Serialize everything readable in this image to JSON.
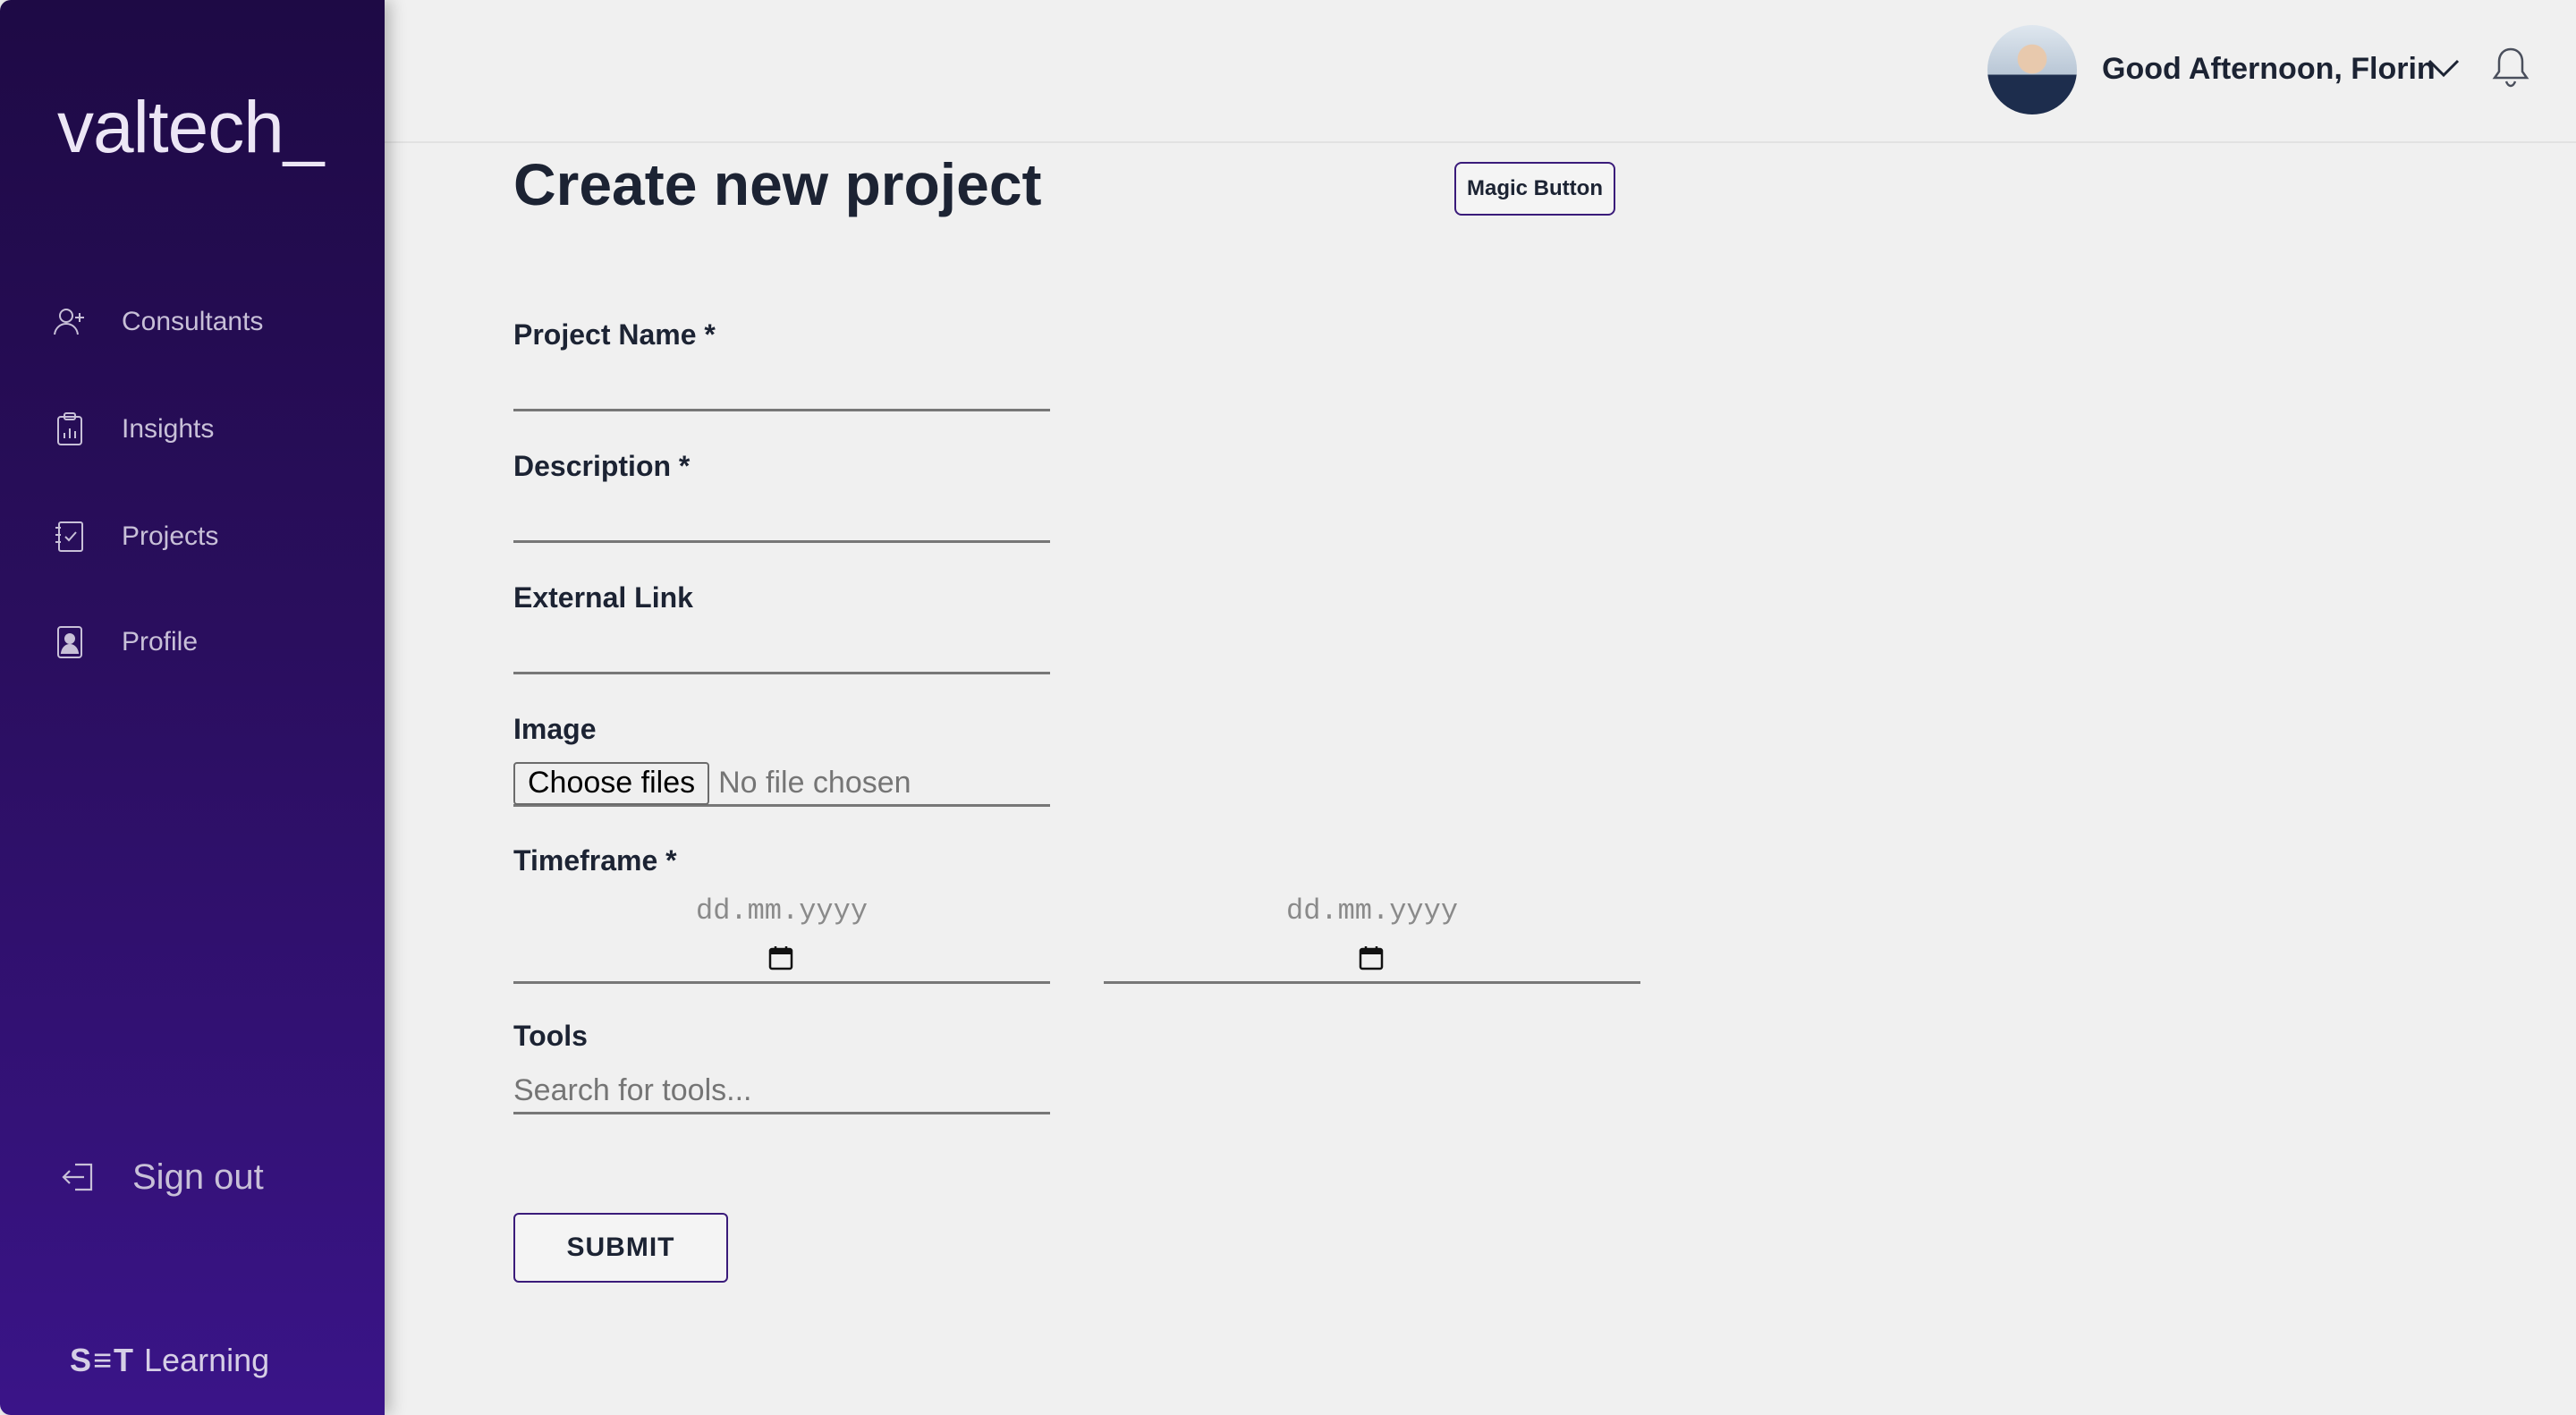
{
  "sidebar": {
    "logo": "valtech_",
    "items": [
      {
        "label": "Consultants",
        "icon": "add-user-icon"
      },
      {
        "label": "Insights",
        "icon": "clipboard-chart-icon"
      },
      {
        "label": "Projects",
        "icon": "checklist-icon"
      },
      {
        "label": "Profile",
        "icon": "profile-card-icon"
      }
    ],
    "signout": {
      "label": "Sign out",
      "icon": "sign-out-icon"
    },
    "footer": {
      "brand": "S≡T",
      "suffix": "Learning"
    }
  },
  "header": {
    "greeting": "Good Afternoon, Florin",
    "icons": [
      "avatar",
      "chevron-down-icon",
      "bell-icon"
    ]
  },
  "main": {
    "title": "Create new project",
    "magic_button": "Magic Button",
    "fields": {
      "project_name": {
        "label": "Project Name *",
        "value": ""
      },
      "description": {
        "label": "Description *",
        "value": ""
      },
      "external_link": {
        "label": "External Link",
        "value": ""
      },
      "image": {
        "label": "Image",
        "button": "Choose files",
        "status": "No file chosen"
      },
      "timeframe": {
        "label": "Timeframe *",
        "start_placeholder": "dd.mm.yyyy",
        "end_placeholder": "dd.mm.yyyy"
      },
      "tools": {
        "label": "Tools",
        "placeholder": "Search for tools..."
      }
    },
    "submit": "SUBMIT"
  },
  "colors": {
    "sidebar_top": "#1e0a45",
    "sidebar_bottom": "#3a1488",
    "accent": "#3a1b7a",
    "background": "#f0f0f0"
  }
}
